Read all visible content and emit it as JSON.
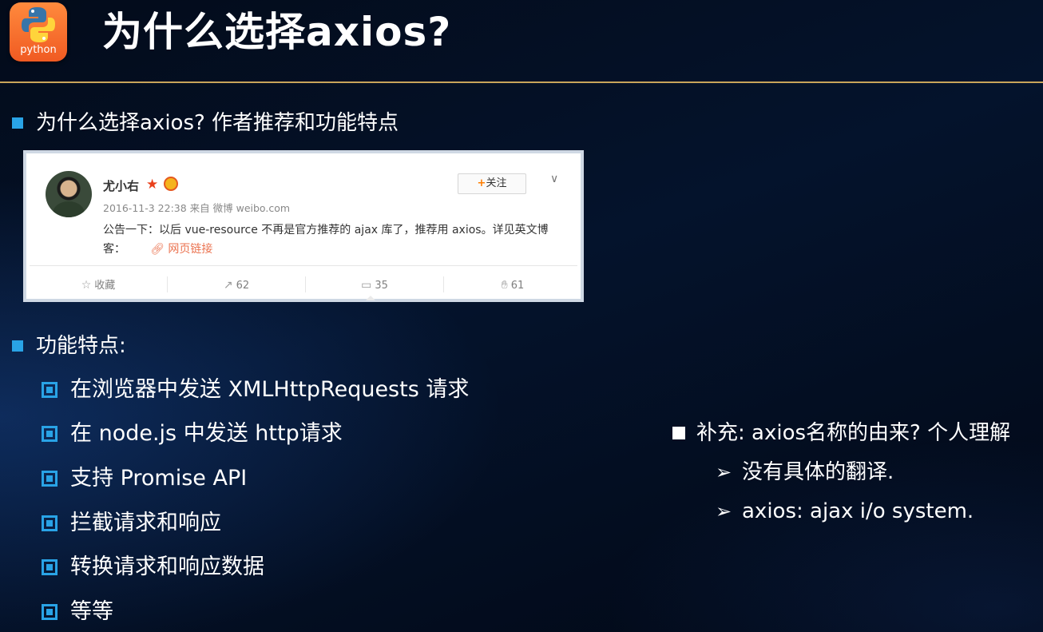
{
  "logo": {
    "text": "python"
  },
  "title": "为什么选择axios?",
  "section1": {
    "heading": "为什么选择axios? 作者推荐和功能特点"
  },
  "weibo": {
    "username": "尤小右",
    "meta": "2016-11-3 22:38 来自 微博 weibo.com",
    "follow_label": "关注",
    "post_text": "公告一下：以后 vue-resource 不再是官方推荐的 ajax 库了，推荐用 axios。详见英文博客：",
    "link_text": "网页链接",
    "actions": [
      {
        "icon": "star-icon",
        "label": "收藏"
      },
      {
        "icon": "share-icon",
        "label": "62"
      },
      {
        "icon": "comment-icon",
        "label": "35"
      },
      {
        "icon": "like-icon",
        "label": "61"
      }
    ]
  },
  "section2": {
    "heading": "功能特点:",
    "items": [
      "在浏览器中发送 XMLHttpRequests 请求",
      "在 node.js 中发送 http请求",
      "支持 Promise API",
      "拦截请求和响应",
      "转换请求和响应数据",
      "等等"
    ]
  },
  "supplement": {
    "heading": "补充: axios名称的由来? 个人理解",
    "items": [
      "没有具体的翻译.",
      "axios: ajax i/o system."
    ]
  },
  "colors": {
    "accent": "#29a3e6",
    "rule": "#c9a45a",
    "background": "#020a18",
    "logo": "#f05a22"
  }
}
